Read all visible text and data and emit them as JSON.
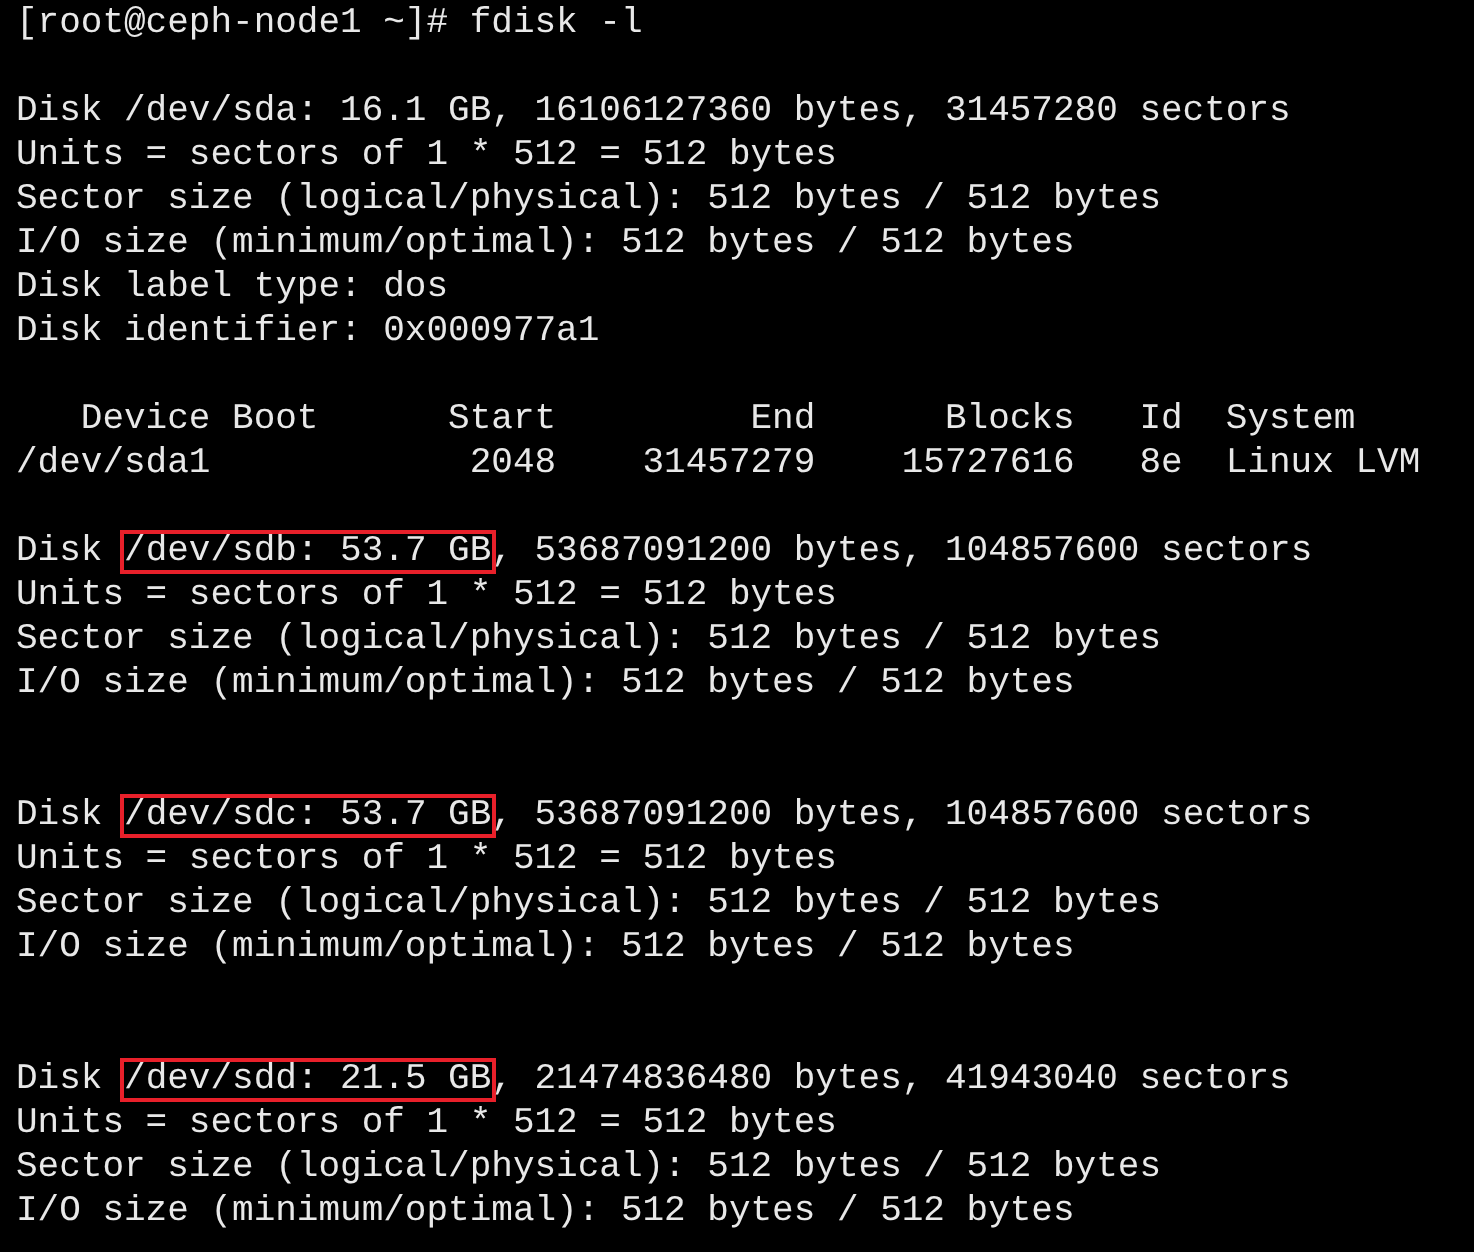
{
  "terminal": {
    "lines": [
      {
        "kind": "text",
        "segments": [
          {
            "text": "[root@ceph-node1 ~]# fdisk -l",
            "boxed": false
          }
        ]
      },
      {
        "kind": "blank"
      },
      {
        "kind": "text",
        "segments": [
          {
            "text": "Disk /dev/sda: 16.1 GB, 16106127360 bytes, 31457280 sectors",
            "boxed": false
          }
        ]
      },
      {
        "kind": "text",
        "segments": [
          {
            "text": "Units = sectors of 1 * 512 = 512 bytes",
            "boxed": false
          }
        ]
      },
      {
        "kind": "text",
        "segments": [
          {
            "text": "Sector size (logical/physical): 512 bytes / 512 bytes",
            "boxed": false
          }
        ]
      },
      {
        "kind": "text",
        "segments": [
          {
            "text": "I/O size (minimum/optimal): 512 bytes / 512 bytes",
            "boxed": false
          }
        ]
      },
      {
        "kind": "text",
        "segments": [
          {
            "text": "Disk label type: dos",
            "boxed": false
          }
        ]
      },
      {
        "kind": "text",
        "segments": [
          {
            "text": "Disk identifier: 0x000977a1",
            "boxed": false
          }
        ]
      },
      {
        "kind": "blank"
      },
      {
        "kind": "text",
        "segments": [
          {
            "text": "   Device Boot      Start         End      Blocks   Id  System",
            "boxed": false
          }
        ]
      },
      {
        "kind": "text",
        "segments": [
          {
            "text": "/dev/sda1            2048    31457279    15727616   8e  Linux LVM",
            "boxed": false
          }
        ]
      },
      {
        "kind": "blank"
      },
      {
        "kind": "text",
        "segments": [
          {
            "text": "Disk ",
            "boxed": false
          },
          {
            "text": "/dev/sdb: 53.7 GB",
            "boxed": true
          },
          {
            "text": ", 53687091200 bytes, 104857600 sectors",
            "boxed": false
          }
        ]
      },
      {
        "kind": "text",
        "segments": [
          {
            "text": "Units = sectors of 1 * 512 = 512 bytes",
            "boxed": false
          }
        ]
      },
      {
        "kind": "text",
        "segments": [
          {
            "text": "Sector size (logical/physical): 512 bytes / 512 bytes",
            "boxed": false
          }
        ]
      },
      {
        "kind": "text",
        "segments": [
          {
            "text": "I/O size (minimum/optimal): 512 bytes / 512 bytes",
            "boxed": false
          }
        ]
      },
      {
        "kind": "blank"
      },
      {
        "kind": "blank"
      },
      {
        "kind": "text",
        "segments": [
          {
            "text": "Disk ",
            "boxed": false
          },
          {
            "text": "/dev/sdc: 53.7 GB",
            "boxed": true
          },
          {
            "text": ", 53687091200 bytes, 104857600 sectors",
            "boxed": false
          }
        ]
      },
      {
        "kind": "text",
        "segments": [
          {
            "text": "Units = sectors of 1 * 512 = 512 bytes",
            "boxed": false
          }
        ]
      },
      {
        "kind": "text",
        "segments": [
          {
            "text": "Sector size (logical/physical): 512 bytes / 512 bytes",
            "boxed": false
          }
        ]
      },
      {
        "kind": "text",
        "segments": [
          {
            "text": "I/O size (minimum/optimal): 512 bytes / 512 bytes",
            "boxed": false
          }
        ]
      },
      {
        "kind": "blank"
      },
      {
        "kind": "blank"
      },
      {
        "kind": "text",
        "segments": [
          {
            "text": "Disk ",
            "boxed": false
          },
          {
            "text": "/dev/sdd: 21.5 GB",
            "boxed": true
          },
          {
            "text": ", 21474836480 bytes, 41943040 sectors",
            "boxed": false
          }
        ]
      },
      {
        "kind": "text",
        "segments": [
          {
            "text": "Units = sectors of 1 * 512 = 512 bytes",
            "boxed": false
          }
        ]
      },
      {
        "kind": "text",
        "segments": [
          {
            "text": "Sector size (logical/physical): 512 bytes / 512 bytes",
            "boxed": false
          }
        ]
      },
      {
        "kind": "text",
        "segments": [
          {
            "text": "I/O size (minimum/optimal): 512 bytes / 512 bytes",
            "boxed": false
          }
        ]
      }
    ]
  }
}
